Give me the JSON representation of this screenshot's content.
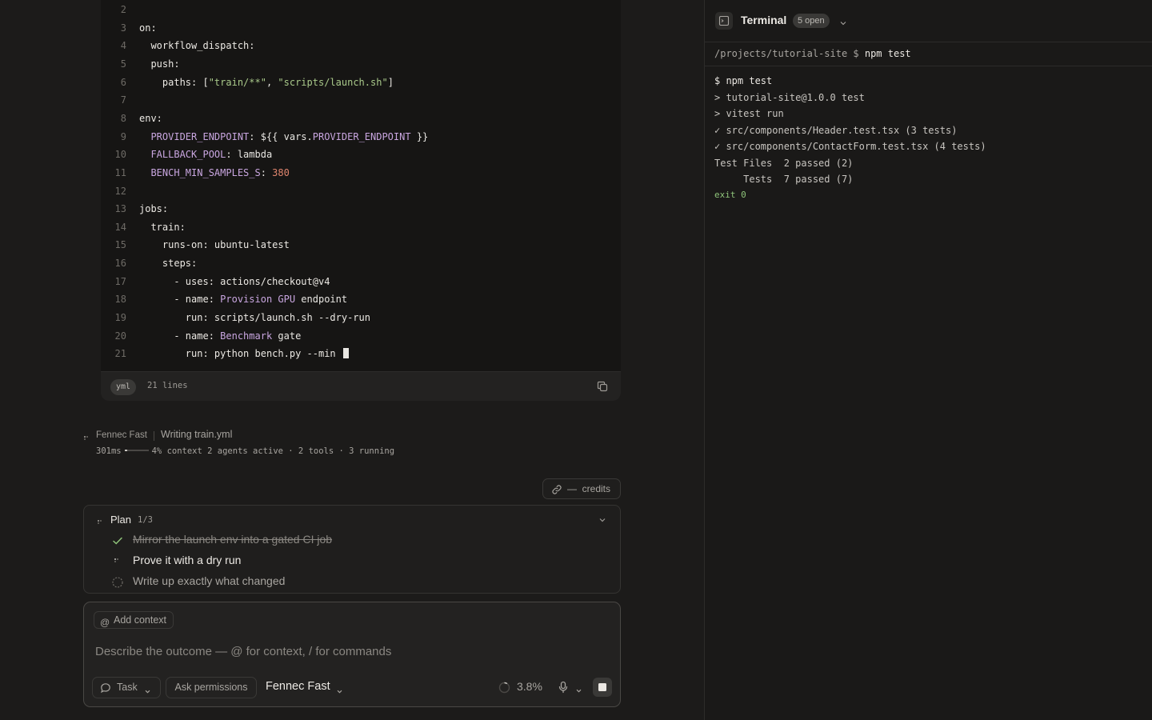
{
  "editor": {
    "lines": [
      {
        "n": "2",
        "tokens": []
      },
      {
        "n": "3",
        "tokens": [
          {
            "t": "on:",
            "c": "tok-key"
          }
        ]
      },
      {
        "n": "4",
        "tokens": [
          {
            "t": "  workflow_dispatch:",
            "c": "tok-key"
          }
        ]
      },
      {
        "n": "5",
        "tokens": [
          {
            "t": "  push:",
            "c": "tok-key"
          }
        ]
      },
      {
        "n": "6",
        "tokens": [
          {
            "t": "    paths: [",
            "c": "tok-key"
          },
          {
            "t": "\"train/**\"",
            "c": "tok-str"
          },
          {
            "t": ", ",
            "c": "tok-plain"
          },
          {
            "t": "\"scripts/launch.sh\"",
            "c": "tok-str"
          },
          {
            "t": "]",
            "c": "tok-plain"
          }
        ]
      },
      {
        "n": "7",
        "tokens": []
      },
      {
        "n": "8",
        "tokens": [
          {
            "t": "env:",
            "c": "tok-key"
          }
        ]
      },
      {
        "n": "9",
        "tokens": [
          {
            "t": "  PROVIDER_ENDPOINT",
            "c": "tok-var"
          },
          {
            "t": ": ${{ vars.",
            "c": "tok-plain"
          },
          {
            "t": "PROVIDER_ENDPOINT",
            "c": "tok-var"
          },
          {
            "t": " }}",
            "c": "tok-plain"
          }
        ]
      },
      {
        "n": "10",
        "tokens": [
          {
            "t": "  FALLBACK_POOL",
            "c": "tok-var"
          },
          {
            "t": ": lambda",
            "c": "tok-plain"
          }
        ]
      },
      {
        "n": "11",
        "tokens": [
          {
            "t": "  BENCH_MIN_SAMPLES_S",
            "c": "tok-var"
          },
          {
            "t": ": ",
            "c": "tok-plain"
          },
          {
            "t": "380",
            "c": "tok-num"
          }
        ]
      },
      {
        "n": "12",
        "tokens": []
      },
      {
        "n": "13",
        "tokens": [
          {
            "t": "jobs:",
            "c": "tok-key"
          }
        ]
      },
      {
        "n": "14",
        "tokens": [
          {
            "t": "  train:",
            "c": "tok-key"
          }
        ]
      },
      {
        "n": "15",
        "tokens": [
          {
            "t": "    runs-on: ubuntu-latest",
            "c": "tok-key"
          }
        ]
      },
      {
        "n": "16",
        "tokens": [
          {
            "t": "    steps:",
            "c": "tok-key"
          }
        ]
      },
      {
        "n": "17",
        "tokens": [
          {
            "t": "      - uses: actions/checkout@v4",
            "c": "tok-key"
          }
        ]
      },
      {
        "n": "18",
        "tokens": [
          {
            "t": "      - name: ",
            "c": "tok-key"
          },
          {
            "t": "Provision GPU",
            "c": "tok-var"
          },
          {
            "t": " endpoint",
            "c": "tok-plain"
          }
        ]
      },
      {
        "n": "19",
        "tokens": [
          {
            "t": "        run: scripts/launch.sh --dry-run",
            "c": "tok-key"
          }
        ]
      },
      {
        "n": "20",
        "tokens": [
          {
            "t": "      - name: ",
            "c": "tok-key"
          },
          {
            "t": "Benchmark",
            "c": "tok-var"
          },
          {
            "t": " gate",
            "c": "tok-plain"
          }
        ]
      },
      {
        "n": "21",
        "tokens": [
          {
            "t": "        run: python bench.py --min ",
            "c": "tok-key"
          }
        ],
        "cursor": true
      }
    ],
    "language": "yml",
    "line_count": "21 lines",
    "copy_icon": "copy-icon"
  },
  "status": {
    "agent": "Fennec Fast",
    "task": "Writing train.yml",
    "latency": "301ms",
    "context_fraction": 0.04,
    "metrics": "4% context 2 agents active · 2 tools · 3 running"
  },
  "credits": {
    "value": "—",
    "label": "credits",
    "icon": "link-icon"
  },
  "plan": {
    "title": "Plan",
    "progress": "1/3",
    "items": [
      {
        "text": "Mirror the launch env into a gated CI job",
        "state": "done"
      },
      {
        "text": "Prove it with a dry run",
        "state": "in-progress"
      },
      {
        "text": "Write up exactly what changed",
        "state": "todo"
      }
    ]
  },
  "composer": {
    "add_context": "Add context",
    "placeholder": "Describe the outcome — @ for context, / for commands",
    "task_label": "Task",
    "permissions_label": "Ask permissions",
    "model_label": "Fennec Fast",
    "usage": "3.8%",
    "usage_fraction": 0.038
  },
  "terminal": {
    "title": "Terminal",
    "open_count": "5 open",
    "cwd": "/projects/tutorial-site $ ",
    "command": "npm test",
    "output": [
      "$ npm test",
      "> tutorial-site@1.0.0 test",
      "> vitest run",
      "✓ src/components/Header.test.tsx (3 tests)",
      "✓ src/components/ContactForm.test.tsx (4 tests)",
      "Test Files  2 passed (2)",
      "     Tests  7 passed (7)"
    ],
    "exit": "exit 0",
    "colors": {
      "success": "#8fc47a"
    }
  }
}
